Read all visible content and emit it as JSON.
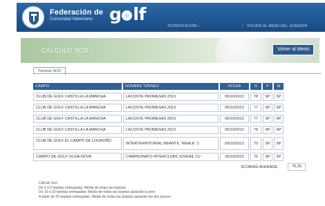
{
  "header": {
    "brand_name": "Federación de",
    "brand_sub": "Comunidad Valenciana",
    "logo_word_pre": "g",
    "logo_word_post": "lf",
    "nav_left": "TECNIFICACIÓN ›",
    "nav_sep": "|",
    "nav_right": "VOLVER AL MENÚ DEL JUGADOR"
  },
  "banner": {
    "title": "CÁLCULO SCO",
    "back_button": "Volver al Menú"
  },
  "tab": {
    "label": "Torneos SCO"
  },
  "table": {
    "headers": [
      "CAMPO",
      "NOMBRE TORNEO",
      "FECHA",
      "G",
      "P",
      "M"
    ],
    "rows": [
      {
        "campo": "CLUB DE GOLF CASTILLA LA MANCHA",
        "torneo": "LACOSTE PROMESAS 2013",
        "fecha": "06/10/2013",
        "g": "78",
        "p": "SP",
        "m": "SP"
      },
      {
        "campo": "CLUB DE GOLF CASTILLA LA MANCHA",
        "torneo": "LACOSTE PROMESAS 2013",
        "fecha": "06/10/2013",
        "g": "77",
        "p": "SP",
        "m": "SP"
      },
      {
        "campo": "CLUB DE GOLF CASTILLA LA MANCHA",
        "torneo": "LACOSTE PROMESAS 2013",
        "fecha": "06/10/2013",
        "g": "77",
        "p": "SP",
        "m": "SP"
      },
      {
        "campo": "CLUB DE GOLF CASTILLA LA MANCHA",
        "torneo": "LACOSTE PROMESAS 2013",
        "fecha": "06/10/2013",
        "g": "78",
        "p": "SP",
        "m": "SP"
      },
      {
        "campo": "CLUB DE GOLF EL CAMPO DE LOGROÑO",
        "torneo": "INTERTERRITORIAL INFANTIL \"REALE\" 2",
        "fecha": "09/10/2013",
        "g": "70",
        "p": "SP",
        "m": "SP"
      },
      {
        "campo": "CAMPO DE GOLF OLIVA-NOVA",
        "torneo": "CAMPEONATO INTERCLUBS JUVENIL CV",
        "fecha": "26/10/2013",
        "g": "76",
        "p": "SP",
        "m": "SP"
      }
    ]
  },
  "scoring": {
    "label": "SCORING AVERAGE:",
    "value": "76,25"
  },
  "notes": [
    "Cálculo Sco:",
    "De 0 a 9 tarjetas entregadas: Media de todas las tarjetas",
    "De 10 a 19 tarjetas entregadas: Media de todas las tarjetas quitando la peor",
    "A partir de 20 tarjetas entregadas: Media de todas las tarjetas quitando las dos peores"
  ]
}
